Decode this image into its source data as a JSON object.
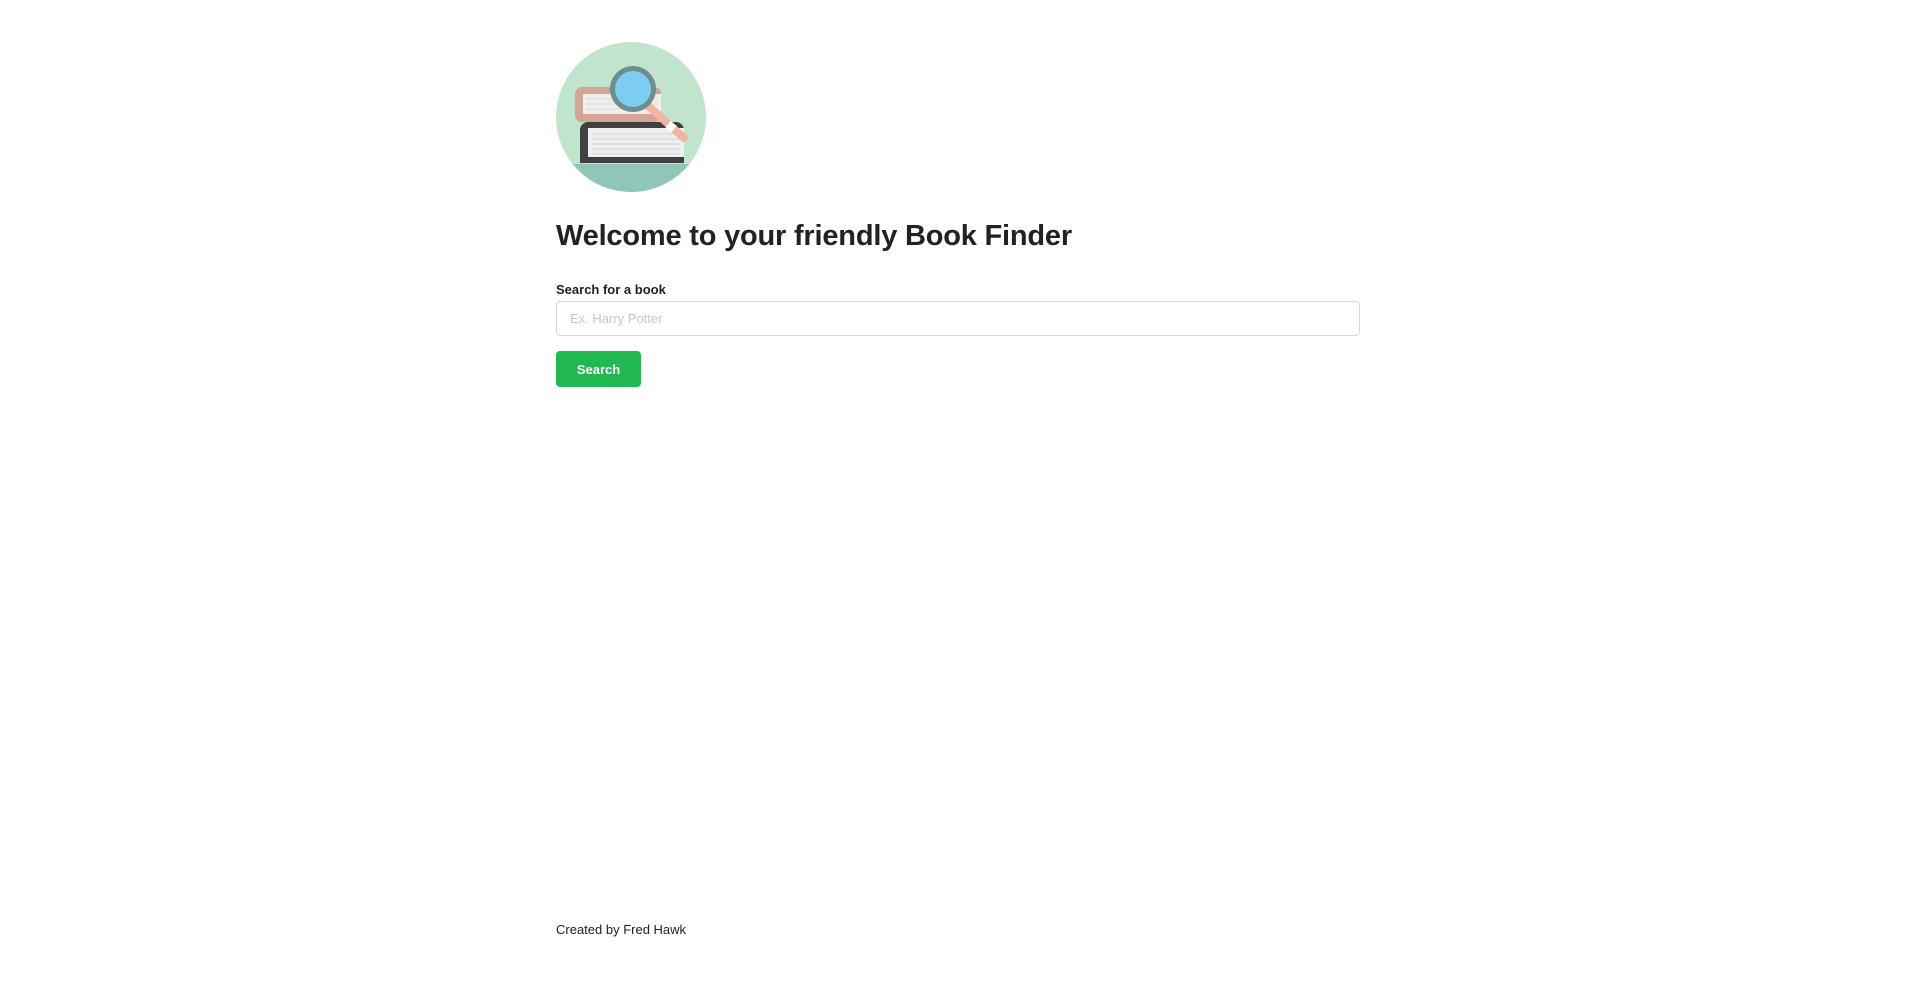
{
  "logo": {
    "icon": "books-magnifier-icon",
    "colors": {
      "circle_bg": "#c1e4cc",
      "ground": "#8fc6b9",
      "book_top": "#d4a592",
      "book_bottom": "#404040",
      "pages": "#efefef",
      "lens": "#7dcdf0",
      "lens_rim": "#6d8e8c",
      "handle": "#f0b4a3"
    }
  },
  "header": {
    "title": "Welcome to your friendly Book Finder"
  },
  "search": {
    "label": "Search for a book",
    "value": "",
    "placeholder": "Ex. Harry Potter",
    "button_label": "Search"
  },
  "footer": {
    "credit": "Created by Fred Hawk"
  },
  "theme": {
    "accent": "#21b94f",
    "text": "#222222"
  }
}
